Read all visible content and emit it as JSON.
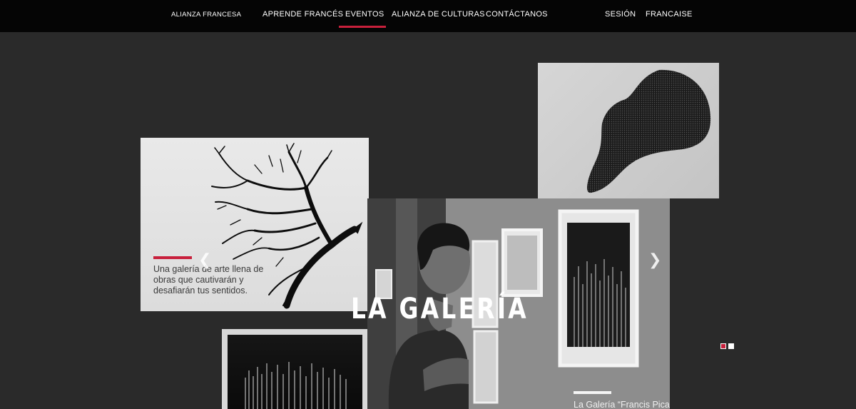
{
  "nav": {
    "brand": "ALIANZA FRANCESA",
    "items": [
      "APRENDE FRANCÉS",
      "EVENTOS",
      "ALIANZA DE CULTURAS",
      "CONTÁCTANOS"
    ],
    "active": "EVENTOS",
    "session": "SESIÓN",
    "language": "FRANCAISE"
  },
  "hero": {
    "title": "LA GALERÍA"
  },
  "slides": {
    "tree_caption": "Una galería de arte llena de obras que cautivarán y desafiarán tus sentidos.",
    "main_caption": "La Galería “Francis Picabia” exhibe las",
    "prev_icon": "chevron-left-icon",
    "next_icon": "chevron-right-icon"
  },
  "pager": {
    "count": 2,
    "active_index": 1
  },
  "colors": {
    "accent": "#c8203c",
    "background": "#2a2a2a",
    "nav": "#050505"
  }
}
